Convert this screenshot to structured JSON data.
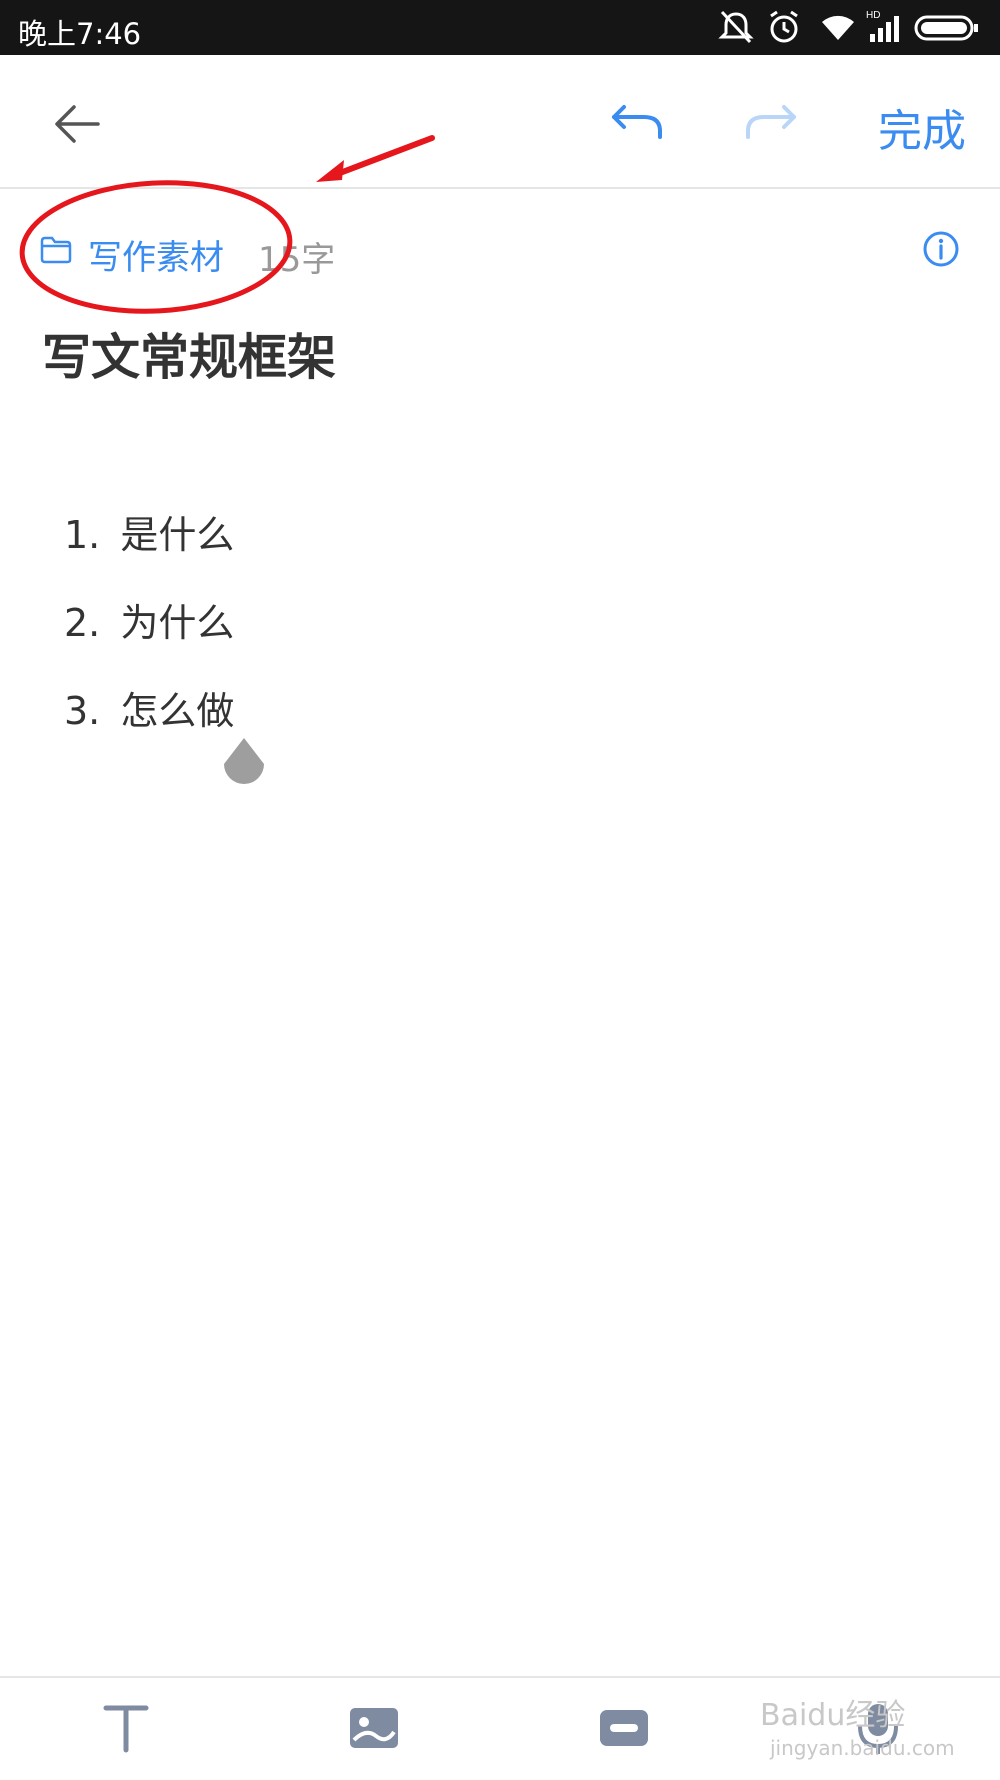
{
  "status_bar": {
    "time": "晚上7:46",
    "icons": [
      "mute-icon",
      "alarm-icon",
      "wifi-icon",
      "signal-icon",
      "battery-icon"
    ],
    "hd_label": "HD"
  },
  "toolbar": {
    "done_label": "完成",
    "back_icon": "back-arrow-icon",
    "undo_icon": "undo-icon",
    "redo_icon": "redo-icon"
  },
  "meta": {
    "folder_name": "写作素材",
    "word_count": "15字"
  },
  "note": {
    "title": "写文常规框架",
    "items": [
      {
        "num": "1.",
        "text": "是什么"
      },
      {
        "num": "2.",
        "text": "为什么"
      },
      {
        "num": "3.",
        "text": "怎么做"
      }
    ]
  },
  "bottom_toolbar": {
    "buttons": [
      "text-format-icon",
      "image-icon",
      "tape-icon",
      "microphone-icon"
    ]
  },
  "watermark": {
    "text": "Baidu经验",
    "sub": "jingyan.baidu.com"
  },
  "colors": {
    "accent": "#3b8cf0",
    "annotation": "#e5161c"
  }
}
